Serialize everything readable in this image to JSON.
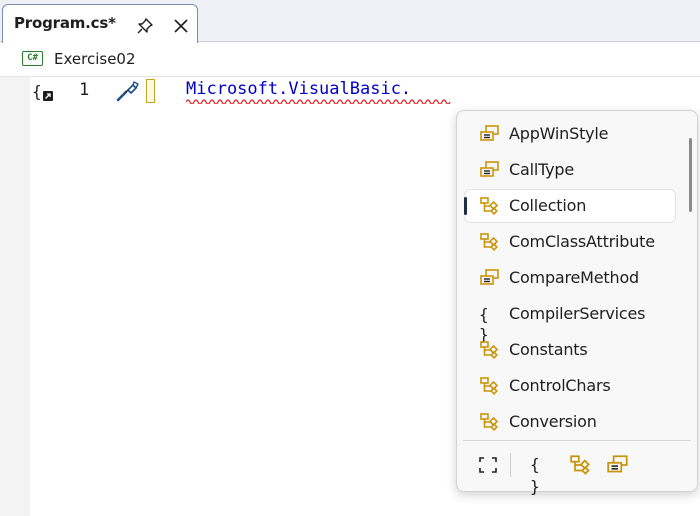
{
  "tab": {
    "title": "Program.cs*"
  },
  "navbar": {
    "project_icon_text": "C#",
    "project_label": "Exercise02"
  },
  "editor": {
    "line_number": "1",
    "code": "Microsoft.VisualBasic."
  },
  "completion": {
    "items": [
      {
        "label": "AppWinStyle",
        "icon": "enum-icon"
      },
      {
        "label": "CallType",
        "icon": "enum-icon"
      },
      {
        "label": "Collection",
        "icon": "class-icon",
        "selected": true
      },
      {
        "label": "ComClassAttribute",
        "icon": "class-icon"
      },
      {
        "label": "CompareMethod",
        "icon": "enum-icon"
      },
      {
        "label": "CompilerServices",
        "icon": "namespace-icon"
      },
      {
        "label": "Constants",
        "icon": "class-icon"
      },
      {
        "label": "ControlChars",
        "icon": "class-icon"
      },
      {
        "label": "Conversion",
        "icon": "class-icon"
      }
    ],
    "footer_filters": [
      "expand-icon",
      "namespace-filter-icon",
      "class-filter-icon",
      "enum-filter-icon"
    ],
    "braces_glyph": "{ }"
  },
  "colors": {
    "accent_gold": "#c9940a",
    "code_blue": "#0000cc",
    "squiggle_red": "#e02020"
  }
}
